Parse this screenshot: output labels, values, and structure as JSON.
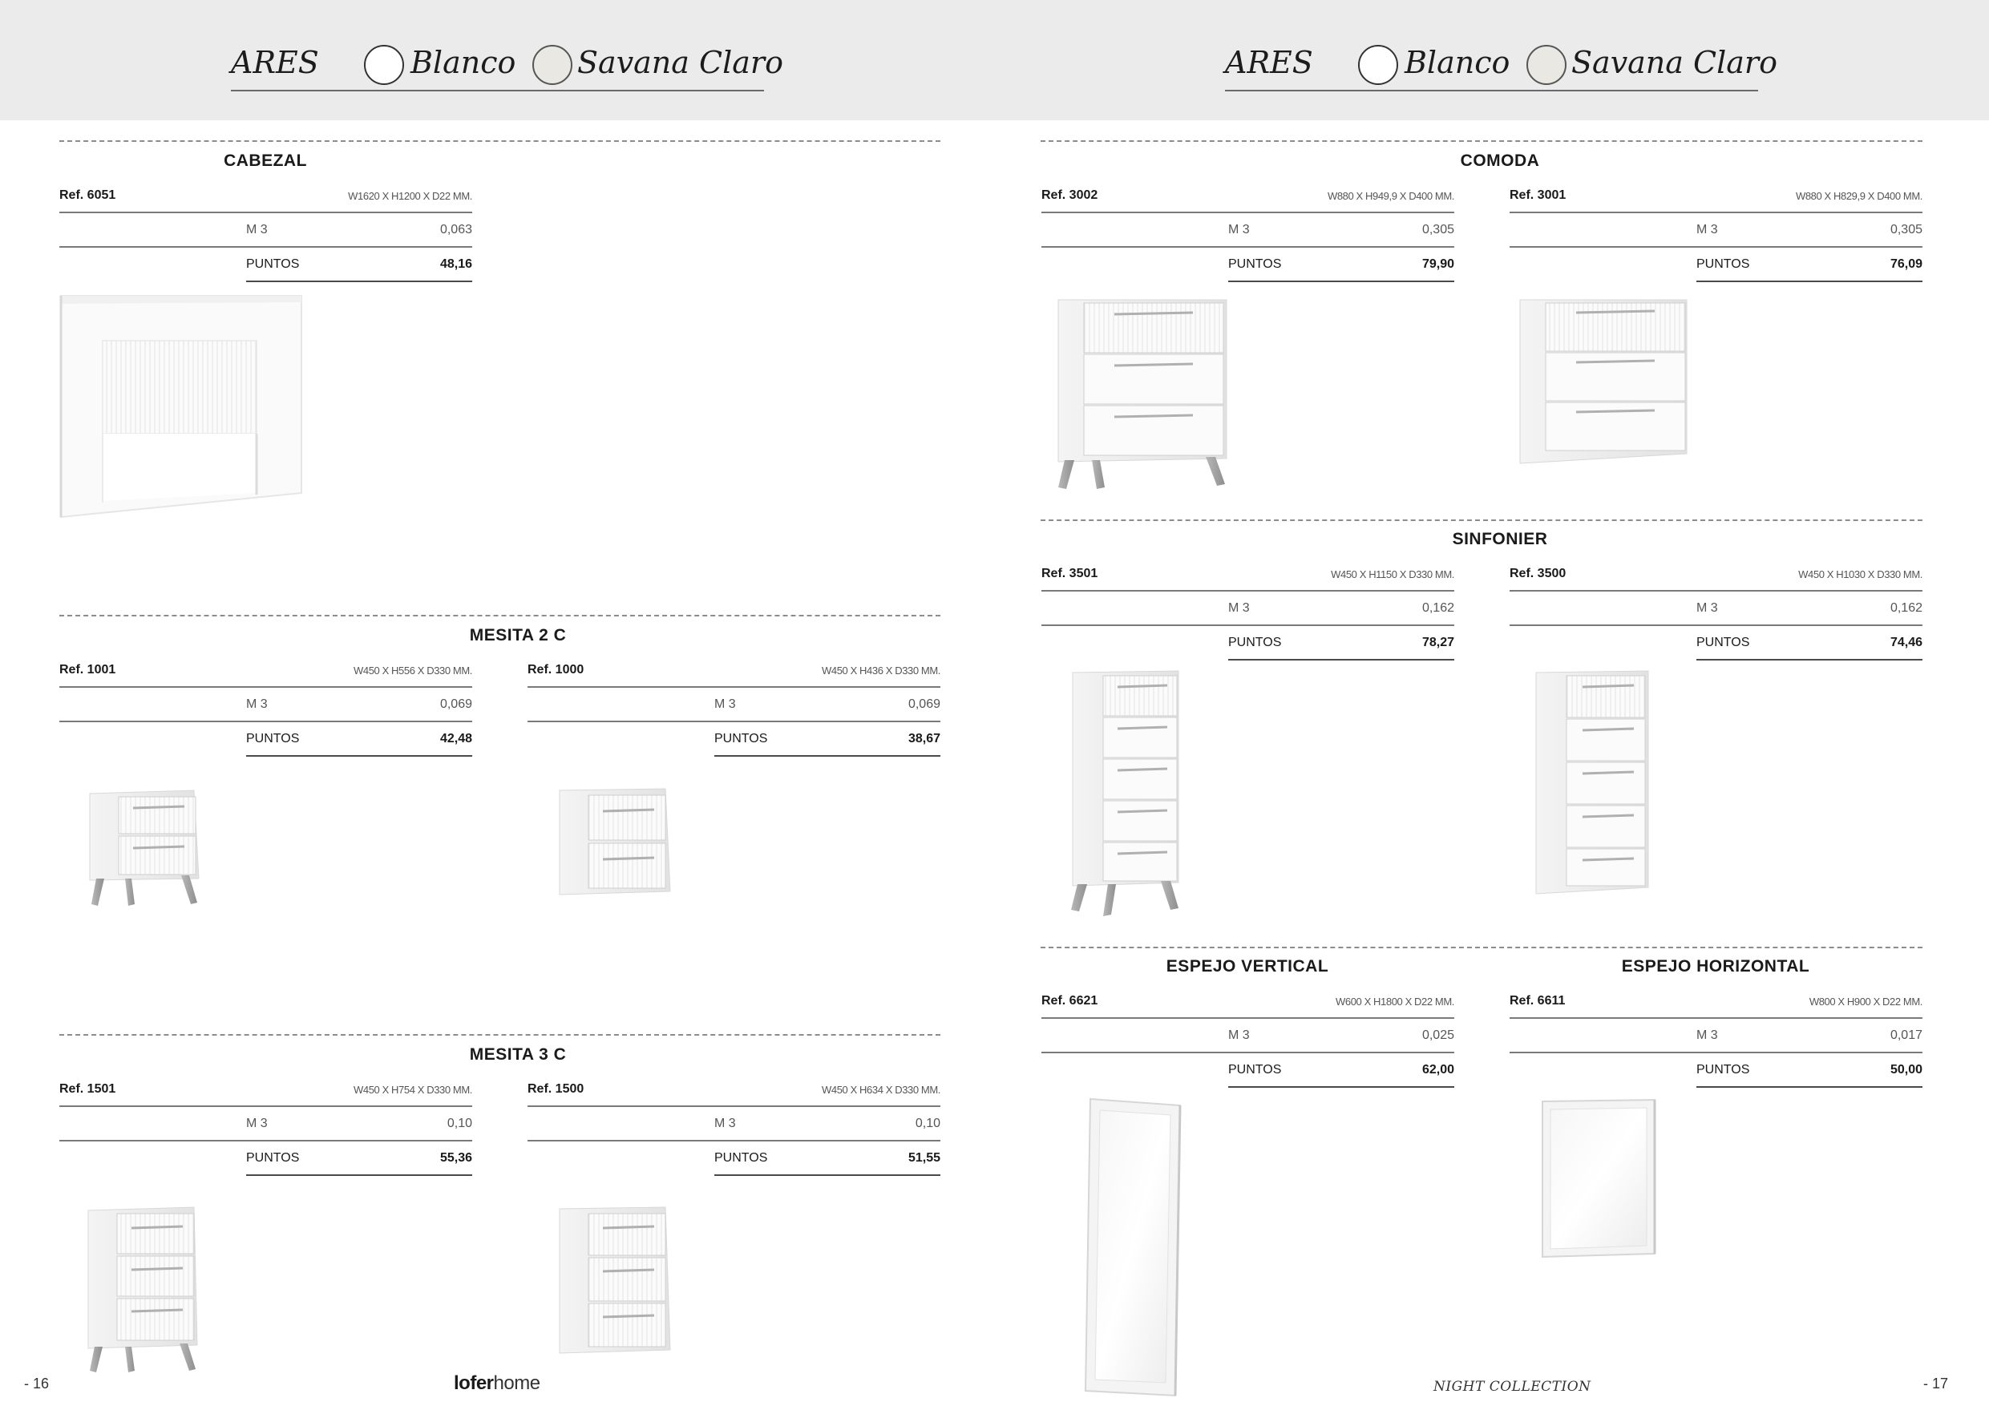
{
  "header": {
    "left": {
      "name": "ARES",
      "color1": "Blanco",
      "color2": "Savana Claro"
    },
    "right": {
      "name": "ARES",
      "color1": "Blanco",
      "color2": "Savana Claro"
    },
    "swatch_colors": {
      "blanco": "#ffffff",
      "savana_claro": "#e9e8e2"
    }
  },
  "left_page": {
    "cabezal": {
      "title": "CABEZAL",
      "products": [
        {
          "ref": "Ref. 6051",
          "dims": "W1620 X H1200 X D22  MM.",
          "m3_label": "M 3",
          "m3": "0,063",
          "puntos_label": "PUNTOS",
          "puntos": "48,16"
        }
      ]
    },
    "mesita2c": {
      "title": "MESITA 2 C",
      "products": [
        {
          "ref": "Ref. 1001",
          "dims": "W450 X H556 X D330  MM.",
          "m3_label": "M 3",
          "m3": "0,069",
          "puntos_label": "PUNTOS",
          "puntos": "42,48"
        },
        {
          "ref": "Ref. 1000",
          "dims": "W450 X H436 X D330  MM.",
          "m3_label": "M 3",
          "m3": "0,069",
          "puntos_label": "PUNTOS",
          "puntos": "38,67"
        }
      ]
    },
    "mesita3c": {
      "title": "MESITA 3 C",
      "products": [
        {
          "ref": "Ref. 1501",
          "dims": "W450 X H754 X D330  MM.",
          "m3_label": "M 3",
          "m3": "0,10",
          "puntos_label": "PUNTOS",
          "puntos": "55,36"
        },
        {
          "ref": "Ref. 1500",
          "dims": "W450 X H634 X D330  MM.",
          "m3_label": "M 3",
          "m3": "0,10",
          "puntos_label": "PUNTOS",
          "puntos": "51,55"
        }
      ]
    }
  },
  "right_page": {
    "comoda": {
      "title": "COMODA",
      "products": [
        {
          "ref": "Ref. 3002",
          "dims": "W880 X H949,9 X D400  MM.",
          "m3_label": "M 3",
          "m3": "0,305",
          "puntos_label": "PUNTOS",
          "puntos": "79,90"
        },
        {
          "ref": "Ref. 3001",
          "dims": "W880 X H829,9 X D400  MM.",
          "m3_label": "M 3",
          "m3": "0,305",
          "puntos_label": "PUNTOS",
          "puntos": "76,09"
        }
      ]
    },
    "sinfonier": {
      "title": "SINFONIER",
      "products": [
        {
          "ref": "Ref. 3501",
          "dims": "W450 X H1150 X D330  MM.",
          "m3_label": "M 3",
          "m3": "0,162",
          "puntos_label": "PUNTOS",
          "puntos": "78,27"
        },
        {
          "ref": "Ref. 3500",
          "dims": "W450 X H1030 X D330  MM.",
          "m3_label": "M 3",
          "m3": "0,162",
          "puntos_label": "PUNTOS",
          "puntos": "74,46"
        }
      ]
    },
    "espejo_vertical": {
      "title": "ESPEJO VERTICAL",
      "products": [
        {
          "ref": "Ref. 6621",
          "dims": "W600 X H1800 X D22  MM.",
          "m3_label": "M 3",
          "m3": "0,025",
          "puntos_label": "PUNTOS",
          "puntos": "62,00"
        }
      ]
    },
    "espejo_horizontal": {
      "title": "ESPEJO HORIZONTAL",
      "products": [
        {
          "ref": "Ref. 6611",
          "dims": "W800 X H900 X D22  MM.",
          "m3_label": "M 3",
          "m3": "0,017",
          "puntos_label": "PUNTOS",
          "puntos": "50,00"
        }
      ]
    }
  },
  "footer": {
    "page_left": "- 16",
    "brand_bold": "lofer",
    "brand_light": "home",
    "collection": "NIGHT COLLECTION",
    "page_right": "- 17"
  }
}
